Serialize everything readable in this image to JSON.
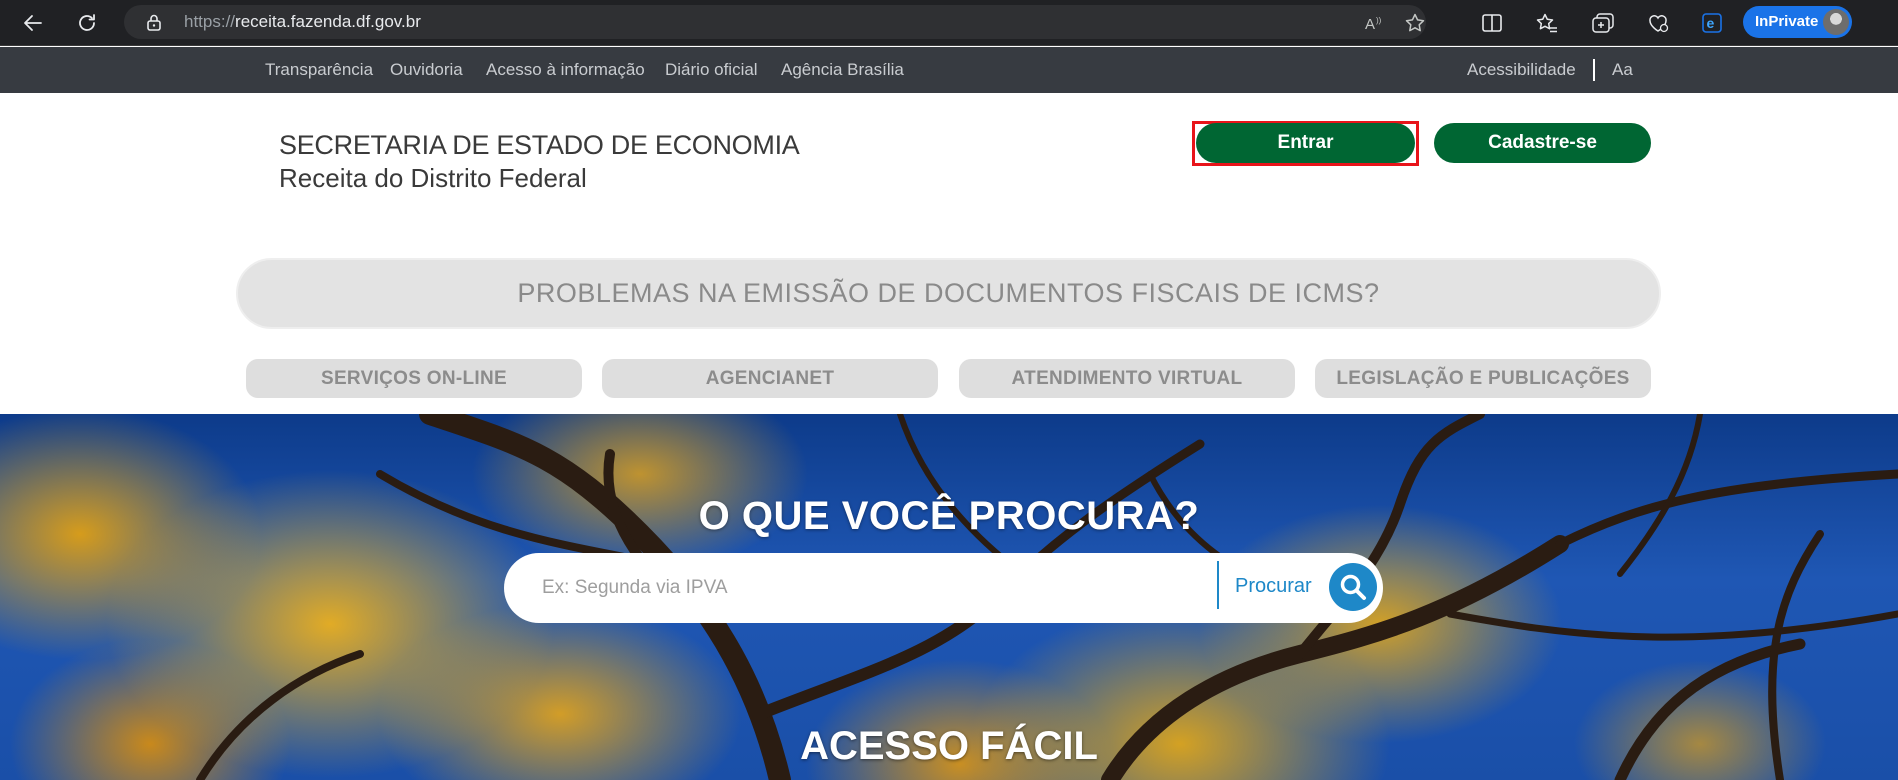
{
  "browser": {
    "url_protocol": "https://",
    "url_host": "receita.fazenda.df.gov.br",
    "inprivate_label": "InPrivate"
  },
  "gov_bar": {
    "links": [
      "Transparência",
      "Ouvidoria",
      "Acesso à informação",
      "Diário oficial",
      "Agência Brasília"
    ],
    "accessibility": "Acessibilidade",
    "font_size": "Aa"
  },
  "header": {
    "org_line1": "SECRETARIA DE ESTADO DE ECONOMIA",
    "org_line2": "Receita do Distrito Federal",
    "login_label": "Entrar",
    "register_label": "Cadastre-se"
  },
  "notice": "PROBLEMAS NA EMISSÃO DE DOCUMENTOS FISCAIS DE ICMS?",
  "service_tabs": [
    "SERVIÇOS ON-LINE",
    "AGENCIANET",
    "ATENDIMENTO VIRTUAL",
    "LEGISLAÇÃO E PUBLICAÇÕES"
  ],
  "hero": {
    "title": "O QUE VOCÊ PROCURA?",
    "search_placeholder": "Ex: Segunda via IPVA",
    "search_label": "Procurar",
    "subtitle": "ACESSO FÁCIL"
  },
  "colors": {
    "brand_green": "#006633",
    "search_blue": "#1e88c8",
    "highlight_red": "#e8141a",
    "gov_bar": "#373b41"
  }
}
